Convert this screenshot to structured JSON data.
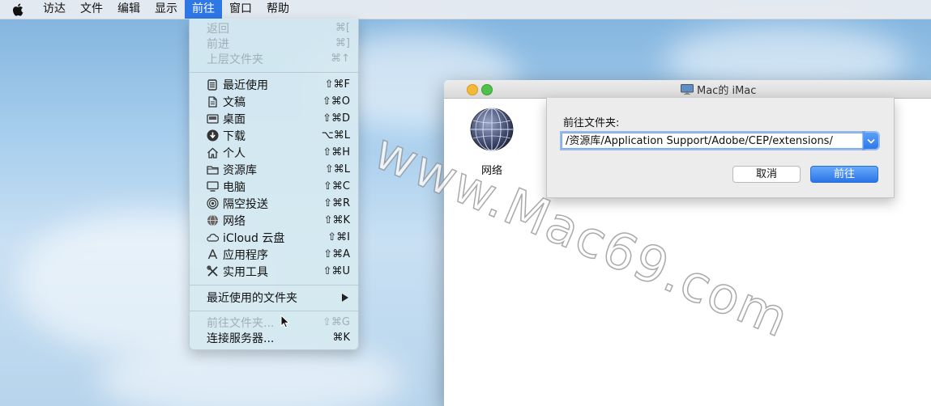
{
  "menubar": {
    "items": [
      "访达",
      "文件",
      "编辑",
      "显示",
      "前往",
      "窗口",
      "帮助"
    ],
    "active_index": 4
  },
  "go_menu": {
    "items": [
      {
        "label": "返回",
        "shortcut": "⌘[",
        "disabled": true,
        "icon": "none"
      },
      {
        "label": "前进",
        "shortcut": "⌘]",
        "disabled": true,
        "icon": "none"
      },
      {
        "label": "上层文件夹",
        "shortcut": "⌘↑",
        "disabled": true,
        "icon": "none"
      },
      {
        "label": "最近使用",
        "shortcut": "⇧⌘F",
        "icon": "recents-icon"
      },
      {
        "label": "文稿",
        "shortcut": "⇧⌘O",
        "icon": "documents-icon"
      },
      {
        "label": "桌面",
        "shortcut": "⇧⌘D",
        "icon": "desktop-icon"
      },
      {
        "label": "下载",
        "shortcut": "⌥⌘L",
        "icon": "download-icon"
      },
      {
        "label": "个人",
        "shortcut": "⇧⌘H",
        "icon": "home-icon"
      },
      {
        "label": "资源库",
        "shortcut": "⇧⌘L",
        "icon": "folder-icon"
      },
      {
        "label": "电脑",
        "shortcut": "⇧⌘C",
        "icon": "computer-icon"
      },
      {
        "label": "隔空投送",
        "shortcut": "⇧⌘R",
        "icon": "airdrop-icon"
      },
      {
        "label": "网络",
        "shortcut": "⇧⌘K",
        "icon": "network-icon"
      },
      {
        "label": "iCloud 云盘",
        "shortcut": "⇧⌘I",
        "icon": "cloud-icon"
      },
      {
        "label": "应用程序",
        "shortcut": "⇧⌘A",
        "icon": "applications-icon"
      },
      {
        "label": "实用工具",
        "shortcut": "⇧⌘U",
        "icon": "utilities-icon"
      },
      {
        "label": "最近使用的文件夹",
        "shortcut": "",
        "icon": "none",
        "submenu": true
      },
      {
        "label": "前往文件夹...",
        "shortcut": "⇧⌘G",
        "disabled": true,
        "icon": "none"
      },
      {
        "label": "连接服务器...",
        "shortcut": "⌘K",
        "icon": "none"
      }
    ]
  },
  "window": {
    "title": "Mac的 iMac",
    "network_label": "网络"
  },
  "sheet": {
    "label": "前往文件夹:",
    "path_value": "/资源库/Application Support/Adobe/CEP/extensions/",
    "cancel_label": "取消",
    "go_label": "前往"
  },
  "watermark": "www.Mac69.com",
  "colors": {
    "accent": "#2e78e6",
    "menu_bg": "#d6eaf1",
    "disabled_text": "#9fb0b6"
  }
}
